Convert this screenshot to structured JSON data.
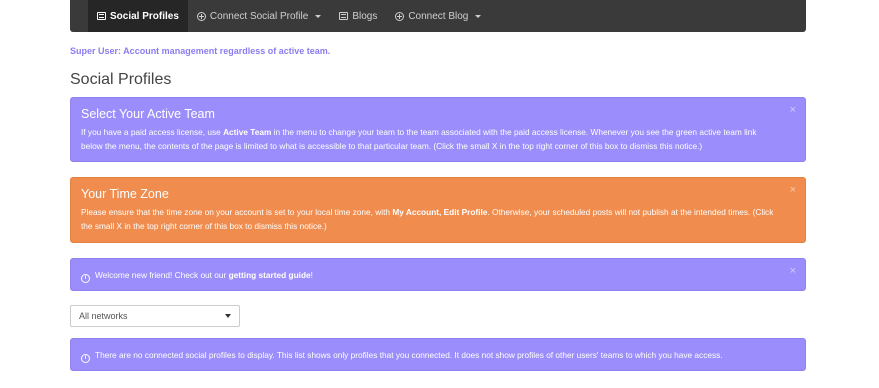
{
  "navbar": {
    "items": [
      {
        "label": "Social Profiles",
        "icon": "list-icon",
        "active": true
      },
      {
        "label": "Connect Social Profile",
        "icon": "circle-plus-icon",
        "dropdown": true
      },
      {
        "label": "Blogs",
        "icon": "list-icon"
      },
      {
        "label": "Connect Blog",
        "icon": "circle-plus-icon",
        "dropdown": true
      }
    ]
  },
  "notice": "Super User: Account management regardless of active team.",
  "page_title": "Social Profiles",
  "alerts": {
    "team": {
      "title": "Select Your Active Team",
      "text_1": "If you have a paid access license, use ",
      "bold_1": "Active Team",
      "text_2": " in the menu to change your team to the team associated with the paid access license. Whenever you see the green active team link below the menu, the contents of the page is limited to what is accessible to that particular team. (Click the small X in the top right corner of this box to dismiss this notice.)",
      "close": "×"
    },
    "timezone": {
      "title": "Your Time Zone",
      "text_1": "Please ensure that the time zone on your account is set to your local time zone, with ",
      "bold_1": "My Account, Edit Profile",
      "text_2": ". Otherwise, your scheduled posts will not publish at the intended times. (Click the small X in the top right corner of this box to dismiss this notice.)",
      "close": "×"
    },
    "welcome": {
      "text_1": "Welcome new friend! Check out our ",
      "link": "getting started guide",
      "text_2": "!",
      "close": "×"
    },
    "empty": {
      "text": "There are no connected social profiles to display. This list shows only profiles that you connected. It does not show profiles of other users' teams to which you have access."
    }
  },
  "filter": {
    "selected": "All networks"
  },
  "colors": {
    "purple": "#9b8dfb",
    "orange": "#ef8c4e",
    "navbar": "#3a3a3a",
    "notice": "#8a7cf0"
  }
}
